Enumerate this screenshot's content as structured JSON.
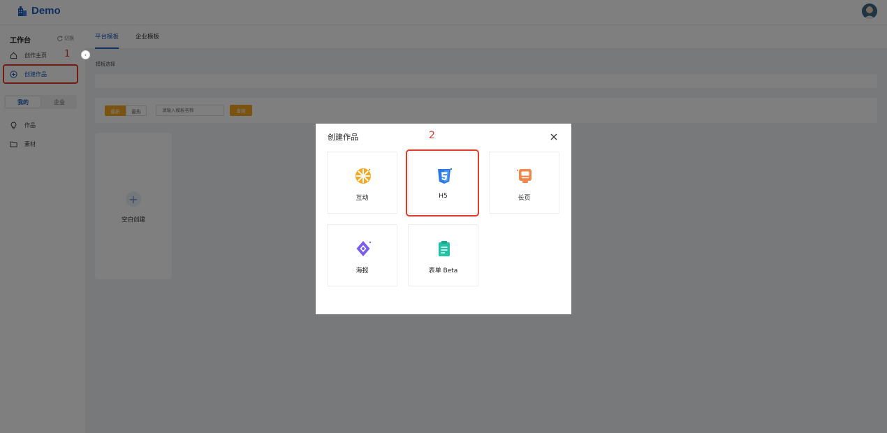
{
  "app": {
    "name": "Demo"
  },
  "sidebar": {
    "workspace_title": "工作台",
    "switch_label": "切换",
    "items": [
      {
        "label": "创作主页",
        "icon": "home-icon"
      },
      {
        "label": "创建作品",
        "icon": "plus-circle-icon"
      }
    ],
    "segment": {
      "mine": "我的",
      "enterprise": "企业"
    },
    "lower_items": [
      {
        "label": "作品",
        "icon": "bulb-icon"
      },
      {
        "label": "素材",
        "icon": "folder-icon"
      }
    ],
    "step_marker": "1"
  },
  "main": {
    "tabs": [
      {
        "label": "平台模板"
      },
      {
        "label": "企业模板"
      }
    ],
    "section_label": "模板选择",
    "filters": {
      "newest": "最新",
      "hot": "最热"
    },
    "search": {
      "placeholder": "请输入模板名称",
      "button": "查询"
    },
    "blank_card": {
      "label": "空白创建"
    }
  },
  "modal": {
    "title": "创建作品",
    "step_marker": "2",
    "options": [
      {
        "label": "互动",
        "icon": "interactive-icon"
      },
      {
        "label": "H5",
        "icon": "html5-icon"
      },
      {
        "label": "长页",
        "icon": "long-page-icon"
      },
      {
        "label": "海报",
        "icon": "poster-icon"
      },
      {
        "label": "表单 Beta",
        "icon": "form-icon"
      }
    ]
  },
  "colors": {
    "accent": "#1f5fbf",
    "orange": "#f5a623",
    "highlight": "#e5392a"
  }
}
